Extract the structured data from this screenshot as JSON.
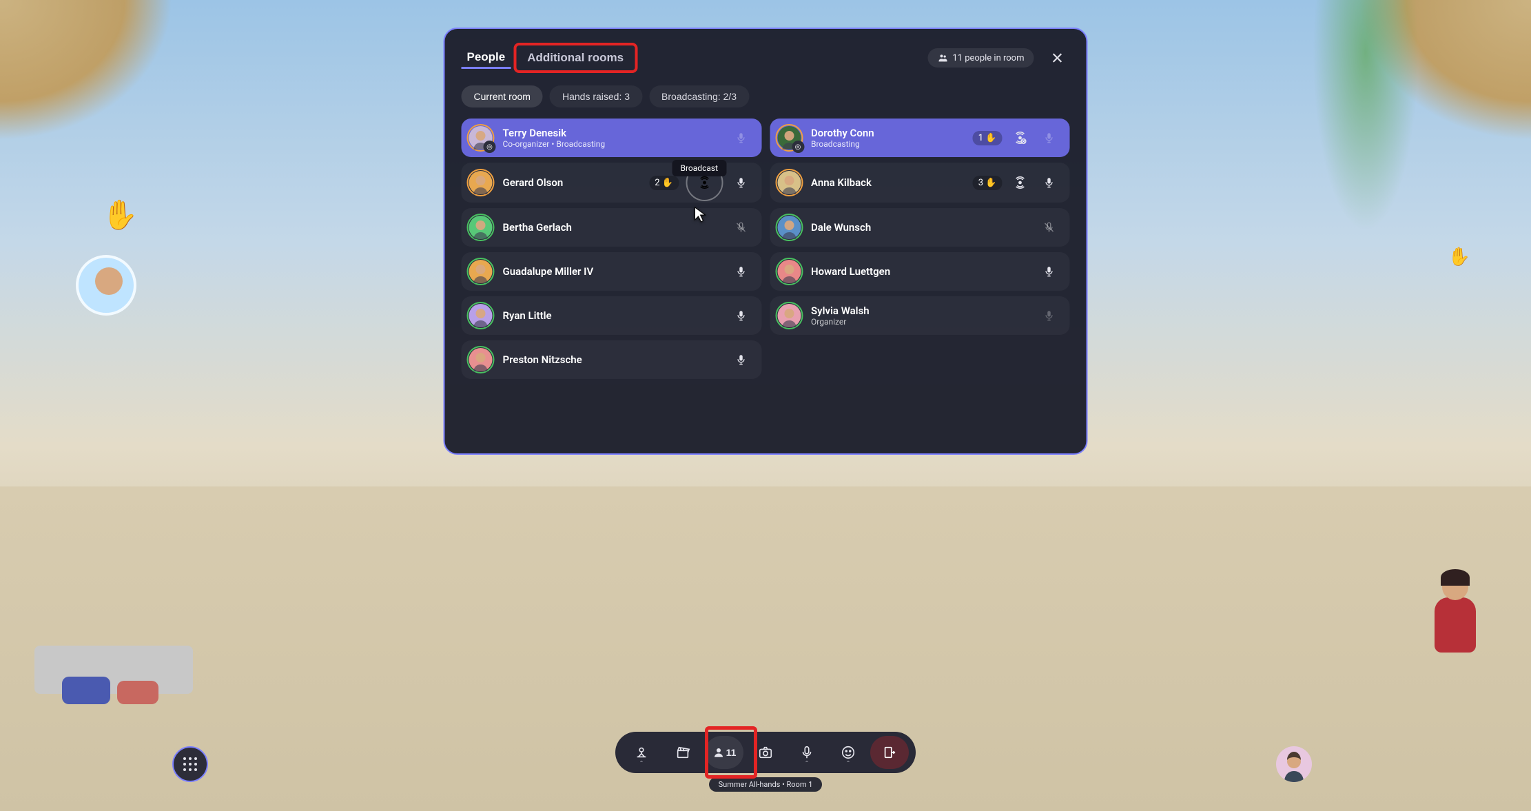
{
  "tabs": {
    "people": "People",
    "additional": "Additional rooms"
  },
  "header": {
    "room_count_label": "11 people in room",
    "room_count": 11
  },
  "filters": {
    "current": "Current room",
    "hands": "Hands raised: 3",
    "broadcasting": "Broadcasting: 2/3"
  },
  "tooltip": {
    "broadcast": "Broadcast"
  },
  "people": [
    {
      "name": "Terry Denesik",
      "sub": "Co-organizer • Broadcasting",
      "highlight": true,
      "avatar_bg": "#c8b8d8",
      "ring": "ring-orange",
      "badge": "◎",
      "mic": "on",
      "mic_muted": true
    },
    {
      "name": "Dorothy Conn",
      "sub": "Broadcasting",
      "highlight": true,
      "avatar_bg": "#3a6a3a",
      "ring": "ring-orange",
      "badge": "◎",
      "hand_num": "1",
      "broadcast_icon": true,
      "broadcast_off": true,
      "mic": "on",
      "mic_muted": true
    },
    {
      "name": "Gerard Olson",
      "sub": "",
      "avatar_bg": "#e8a850",
      "ring": "ring-orange",
      "hand_num": "2",
      "broadcast_circle": true,
      "mic": "on"
    },
    {
      "name": "Anna Kilback",
      "sub": "",
      "avatar_bg": "#d8c088",
      "ring": "ring-orange",
      "hand_num": "3",
      "broadcast_icon": true,
      "mic": "on"
    },
    {
      "name": "Bertha Gerlach",
      "sub": "",
      "avatar_bg": "#58c878",
      "ring": "ring-green",
      "mic": "off"
    },
    {
      "name": "Dale Wunsch",
      "sub": "",
      "avatar_bg": "#5a90c8",
      "ring": "ring-green",
      "mic": "off"
    },
    {
      "name": "Guadalupe Miller IV",
      "sub": "",
      "avatar_bg": "#e8a850",
      "ring": "ring-green",
      "mic": "on"
    },
    {
      "name": "Howard Luettgen",
      "sub": "",
      "avatar_bg": "#e88888",
      "ring": "ring-green",
      "mic": "on"
    },
    {
      "name": "Ryan Little",
      "sub": "",
      "avatar_bg": "#b8a0e8",
      "ring": "ring-green",
      "mic": "on"
    },
    {
      "name": "Sylvia Walsh",
      "sub": "Organizer",
      "avatar_bg": "#e8a0b0",
      "ring": "ring-green",
      "mic": "on",
      "mic_muted": true
    },
    {
      "name": "Preston Nitzsche",
      "sub": "",
      "avatar_bg": "#e89090",
      "ring": "ring-green",
      "mic": "on"
    }
  ],
  "toolbar": {
    "people_count": "11"
  },
  "footer": {
    "room_label": "Summer All-hands • Room 1"
  },
  "hand_emoji": "✋"
}
